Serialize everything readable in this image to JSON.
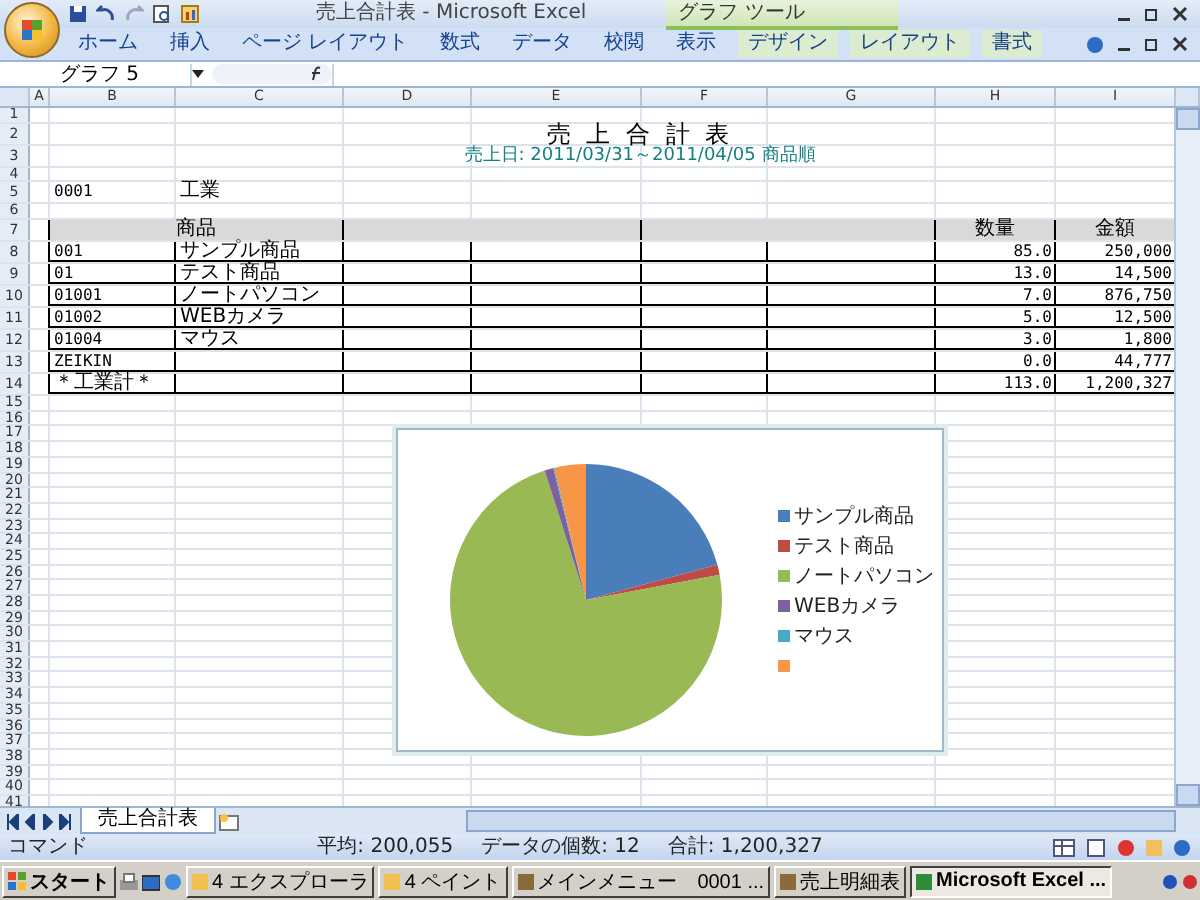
{
  "window": {
    "title": "売上合計表 - Microsoft Excel",
    "context_label": "グラフ ツール"
  },
  "ribbon_tabs": [
    {
      "label": "ホーム",
      "kind": "normal"
    },
    {
      "label": "挿入",
      "kind": "normal"
    },
    {
      "label": "ページ レイアウト",
      "kind": "normal"
    },
    {
      "label": "数式",
      "kind": "normal"
    },
    {
      "label": "データ",
      "kind": "normal"
    },
    {
      "label": "校閲",
      "kind": "normal"
    },
    {
      "label": "表示",
      "kind": "normal"
    },
    {
      "label": "デザイン",
      "kind": "context"
    },
    {
      "label": "レイアウト",
      "kind": "context"
    },
    {
      "label": "書式",
      "kind": "context"
    }
  ],
  "name_box": "グラフ 5",
  "columns": [
    "A",
    "B",
    "C",
    "D",
    "E",
    "F",
    "G",
    "H",
    "I"
  ],
  "rows": [
    "1",
    "2",
    "3",
    "4",
    "5",
    "6",
    "7",
    "8",
    "9",
    "10",
    "11",
    "12",
    "13",
    "14",
    "15",
    "16",
    "17",
    "18",
    "19",
    "20",
    "21",
    "22",
    "23",
    "24",
    "25",
    "26",
    "27",
    "28",
    "29",
    "30",
    "31",
    "32",
    "33",
    "34",
    "35",
    "36",
    "37",
    "38",
    "39",
    "40",
    "41"
  ],
  "sheet": {
    "title": "売 上 合 計 表",
    "subtitle": "売上日: 2011/03/31～2011/04/05 商品順",
    "group_code": "0001",
    "group_name": "工業",
    "header": {
      "product": "商品",
      "qty": "数量",
      "amount": "金額"
    },
    "items": [
      {
        "code": "001",
        "name": "サンプル商品",
        "qty": "85.0",
        "amount": "250,000"
      },
      {
        "code": "01",
        "name": "テスト商品",
        "qty": "13.0",
        "amount": "14,500"
      },
      {
        "code": "01001",
        "name": "ノートパソコン",
        "qty": "7.0",
        "amount": "876,750"
      },
      {
        "code": "01002",
        "name": "WEBカメラ",
        "qty": "5.0",
        "amount": "12,500"
      },
      {
        "code": "01004",
        "name": "マウス",
        "qty": "3.0",
        "amount": "1,800"
      },
      {
        "code": "ZEIKIN",
        "qty": "0.0",
        "amount": "44,777"
      }
    ],
    "total": {
      "label": "＊工業計＊",
      "qty": "113.0",
      "amount": "1,200,327"
    }
  },
  "chart": {
    "legend": [
      {
        "label": "サンプル商品",
        "color": "#4a7ebb"
      },
      {
        "label": "テスト商品",
        "color": "#be4b48"
      },
      {
        "label": "ノートパソコン",
        "color": "#98b954"
      },
      {
        "label": "WEBカメラ",
        "color": "#7d60a0"
      },
      {
        "label": "マウス",
        "color": "#46aac5"
      },
      {
        "color": "#f79646"
      }
    ]
  },
  "sheet_tabs": [
    {
      "label": "売上合計表",
      "selected": true
    }
  ],
  "status_bar": {
    "mode": "コマンド",
    "average": "平均: 200,055",
    "count": "データの個数: 12",
    "sum": "合計: 1,200,327"
  },
  "taskbar": {
    "start": "スタート",
    "buttons": [
      {
        "label": "4 エクスプローラ",
        "kind": "group"
      },
      {
        "label": "4 ペイント",
        "kind": "group"
      },
      {
        "label": "メインメニュー　0001 ...",
        "kind": "app"
      },
      {
        "label": "売上明細表",
        "kind": "app"
      },
      {
        "label": "Microsoft Excel ...",
        "kind": "active"
      }
    ]
  }
}
